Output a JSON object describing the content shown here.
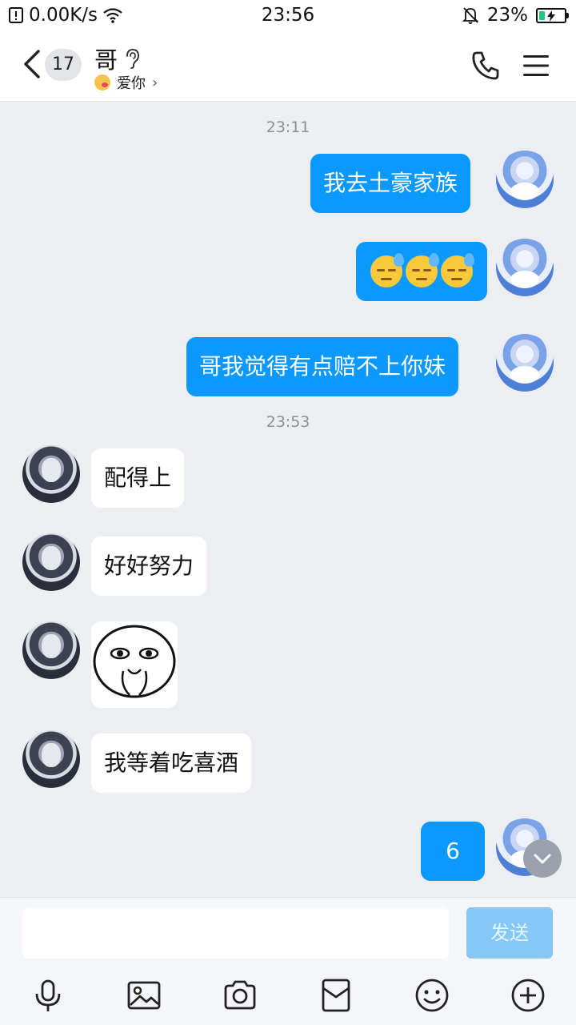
{
  "status_bar": {
    "speed": "0.00K/s",
    "time": "23:56",
    "battery": "23%",
    "battery_level": 0.23,
    "icons": [
      "sim-icon",
      "wifi-icon",
      "mute-bell-icon",
      "battery-charging-icon"
    ]
  },
  "header": {
    "unread_count": "17",
    "contact_name": "哥",
    "subtitle": "爱你",
    "icons": [
      "back-icon",
      "ear-icon",
      "phone-icon",
      "menu-icon"
    ]
  },
  "messages": {
    "time_1": "23:11",
    "m1": "我去土豪家族",
    "m3": "哥我觉得有点赔不上你妹",
    "time_2": "23:53",
    "m4": "配得上",
    "m5": "好好努力",
    "m7": "我等着吃喜酒",
    "m8": "6"
  },
  "emoji_message": {
    "emoji": "downcast-face-with-sweat",
    "count": 3
  },
  "sticker": {
    "icon": "shy-face-sticker"
  },
  "input_bar": {
    "placeholder": "",
    "send_label": "发送",
    "tools": [
      "microphone-icon",
      "image-icon",
      "camera-icon",
      "red-packet-icon",
      "emoji-icon",
      "plus-icon"
    ]
  },
  "colors": {
    "outgoing_bubble": "#0b99ff",
    "incoming_bubble": "#ffffff",
    "chat_background": "#edeef2",
    "send_button": "#85c8f8"
  }
}
